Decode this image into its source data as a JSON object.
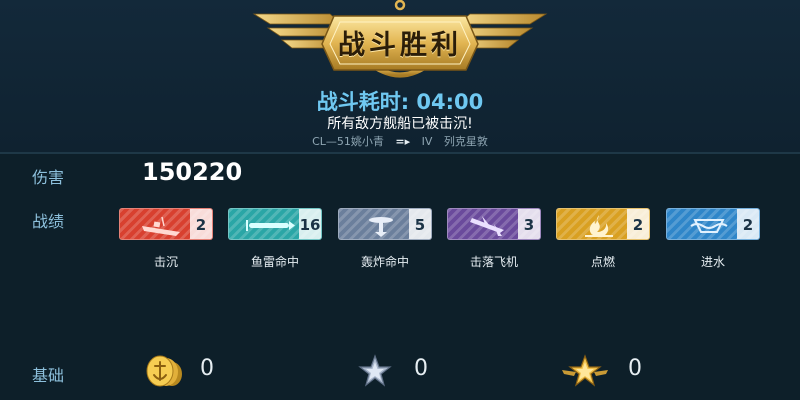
{
  "header": {
    "title": "战斗胜利",
    "duration_label": "战斗耗时: 04:00",
    "result_text": "所有敌方舰船已被击沉!",
    "ship_name": "CL—51姚小青",
    "ship_tier": "IV",
    "ship_next": "列克星敦"
  },
  "damage": {
    "label": "伤害",
    "value": "150220"
  },
  "record": {
    "label": "战绩",
    "items": [
      {
        "name": "击沉",
        "count": "2",
        "color": "#d8402f",
        "icon": "ship-sink-icon"
      },
      {
        "name": "鱼雷命中",
        "count": "16",
        "color": "#2aa6a6",
        "icon": "torpedo-icon"
      },
      {
        "name": "轰炸命中",
        "count": "5",
        "color": "#6b7f9c",
        "icon": "bomb-icon"
      },
      {
        "name": "击落飞机",
        "count": "3",
        "color": "#6a4a9c",
        "icon": "plane-down-icon"
      },
      {
        "name": "点燃",
        "count": "2",
        "color": "#d9a021",
        "icon": "fire-icon"
      },
      {
        "name": "进水",
        "count": "2",
        "color": "#2f86c9",
        "icon": "flood-icon"
      }
    ]
  },
  "basic": {
    "label": "基础",
    "items": [
      {
        "icon": "gold-coin-icon",
        "value": "0"
      },
      {
        "icon": "silver-star-icon",
        "value": "0"
      },
      {
        "icon": "gold-winged-star-icon",
        "value": "0"
      }
    ]
  }
}
